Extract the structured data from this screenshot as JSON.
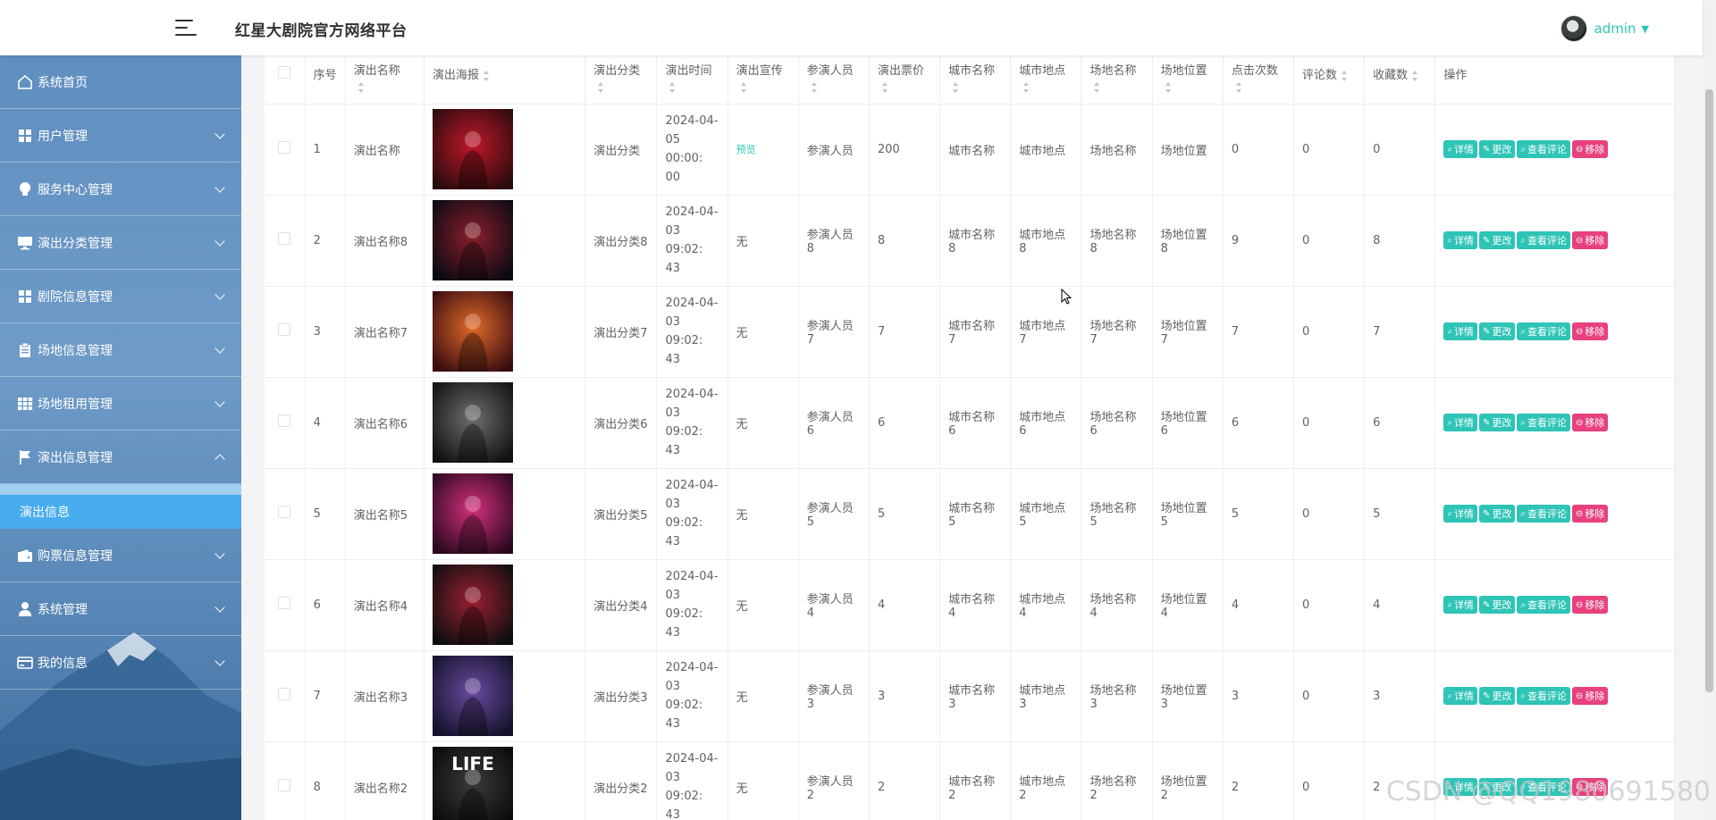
{
  "header": {
    "title": "红星大剧院官方网络平台",
    "user": "admin"
  },
  "sidebar": {
    "items": [
      {
        "label": "系统首页",
        "icon": "home-icon",
        "has_children": false
      },
      {
        "label": "用户管理",
        "icon": "grid-icon",
        "has_children": true
      },
      {
        "label": "服务中心管理",
        "icon": "lightbulb-icon",
        "has_children": true
      },
      {
        "label": "演出分类管理",
        "icon": "monitor-icon",
        "has_children": true
      },
      {
        "label": "剧院信息管理",
        "icon": "grid-icon",
        "has_children": true
      },
      {
        "label": "场地信息管理",
        "icon": "clipboard-icon",
        "has_children": true
      },
      {
        "label": "场地租用管理",
        "icon": "apps-icon",
        "has_children": true
      },
      {
        "label": "演出信息管理",
        "icon": "flag-icon",
        "has_children": true,
        "expanded": true
      },
      {
        "label": "购票信息管理",
        "icon": "wallet-icon",
        "has_children": true
      },
      {
        "label": "系统管理",
        "icon": "user-icon",
        "has_children": true
      },
      {
        "label": "我的信息",
        "icon": "card-icon",
        "has_children": true
      }
    ],
    "active_sub": "演出信息"
  },
  "table": {
    "headers": [
      "序号",
      "演出名称",
      "演出海报",
      "演出分类",
      "演出时间",
      "演出宣传",
      "参演人员",
      "演出票价",
      "城市名称",
      "城市地点",
      "场地名称",
      "场地位置",
      "点击次数",
      "评论数",
      "收藏数",
      "操作"
    ],
    "rows": [
      {
        "no": "1",
        "name": "演出名称",
        "category": "演出分类",
        "time": [
          "2024-04-",
          "05 00:00:",
          "00"
        ],
        "promo": "预览",
        "performers": "参演人员",
        "price": "200",
        "city": "城市名称",
        "city_place": "城市地点",
        "venue": "场地名称",
        "venue_loc": "场地位置",
        "clicks": "0",
        "comments": "0",
        "favorites": "0",
        "poster_colors": [
          "#2a0b0d",
          "#c0182a"
        ]
      },
      {
        "no": "2",
        "name": "演出名称8",
        "category": "演出分类8",
        "time": [
          "2024-04-",
          "03 09:02:",
          "43"
        ],
        "promo": "无",
        "performers": "参演人员8",
        "price": "8",
        "city": "城市名称8",
        "city_place": "城市地点8",
        "venue": "场地名称8",
        "venue_loc": "场地位置8",
        "clicks": "9",
        "comments": "0",
        "favorites": "8",
        "poster_colors": [
          "#0a0a12",
          "#8a1f2c"
        ]
      },
      {
        "no": "3",
        "name": "演出名称7",
        "category": "演出分类7",
        "time": [
          "2024-04-",
          "03 09:02:",
          "43"
        ],
        "promo": "无",
        "performers": "参演人员7",
        "price": "7",
        "city": "城市名称7",
        "city_place": "城市地点7",
        "venue": "场地名称7",
        "venue_loc": "场地位置7",
        "clicks": "7",
        "comments": "0",
        "favorites": "7",
        "poster_colors": [
          "#3a0c10",
          "#e06a2a"
        ]
      },
      {
        "no": "4",
        "name": "演出名称6",
        "category": "演出分类6",
        "time": [
          "2024-04-",
          "03 09:02:",
          "43"
        ],
        "promo": "无",
        "performers": "参演人员6",
        "price": "6",
        "city": "城市名称6",
        "city_place": "城市地点6",
        "venue": "场地名称6",
        "venue_loc": "场地位置6",
        "clicks": "6",
        "comments": "0",
        "favorites": "6",
        "poster_colors": [
          "#111111",
          "#6e6e6e"
        ]
      },
      {
        "no": "5",
        "name": "演出名称5",
        "category": "演出分类5",
        "time": [
          "2024-04-",
          "03 09:02:",
          "43"
        ],
        "promo": "无",
        "performers": "参演人员5",
        "price": "5",
        "city": "城市名称5",
        "city_place": "城市地点5",
        "venue": "场地名称5",
        "venue_loc": "场地位置5",
        "clicks": "5",
        "comments": "0",
        "favorites": "5",
        "poster_colors": [
          "#2a0820",
          "#d2307a"
        ]
      },
      {
        "no": "6",
        "name": "演出名称4",
        "category": "演出分类4",
        "time": [
          "2024-04-",
          "03 09:02:",
          "43"
        ],
        "promo": "无",
        "performers": "参演人员4",
        "price": "4",
        "city": "城市名称4",
        "city_place": "城市地点4",
        "venue": "场地名称4",
        "venue_loc": "场地位置4",
        "clicks": "4",
        "comments": "0",
        "favorites": "4",
        "poster_colors": [
          "#0e0e10",
          "#9a2030"
        ]
      },
      {
        "no": "7",
        "name": "演出名称3",
        "category": "演出分类3",
        "time": [
          "2024-04-",
          "03 09:02:",
          "43"
        ],
        "promo": "无",
        "performers": "参演人员3",
        "price": "3",
        "city": "城市名称3",
        "city_place": "城市地点3",
        "venue": "场地名称3",
        "venue_loc": "场地位置3",
        "clicks": "3",
        "comments": "0",
        "favorites": "3",
        "poster_colors": [
          "#14122a",
          "#6a4aa0"
        ]
      },
      {
        "no": "8",
        "name": "演出名称2",
        "category": "演出分类2",
        "time": [
          "2024-04-",
          "03 09:02:",
          "43"
        ],
        "promo": "无",
        "performers": "参演人员2",
        "price": "2",
        "city": "城市名称2",
        "city_place": "城市地点2",
        "venue": "场地名称2",
        "venue_loc": "场地位置2",
        "clicks": "2",
        "comments": "0",
        "favorites": "2",
        "poster_colors": [
          "#0a0a0a",
          "#3a3a3a"
        ],
        "poster_text": "LIFE"
      }
    ],
    "actions": {
      "detail": "详情",
      "edit": "更改",
      "comments": "查看评论",
      "remove": "移除"
    }
  },
  "watermark": "CSDN @QQ1980691580",
  "colors": {
    "accent": "#2ec4b6",
    "danger": "#e8417d",
    "sidebar_active": "#39a5f0"
  }
}
